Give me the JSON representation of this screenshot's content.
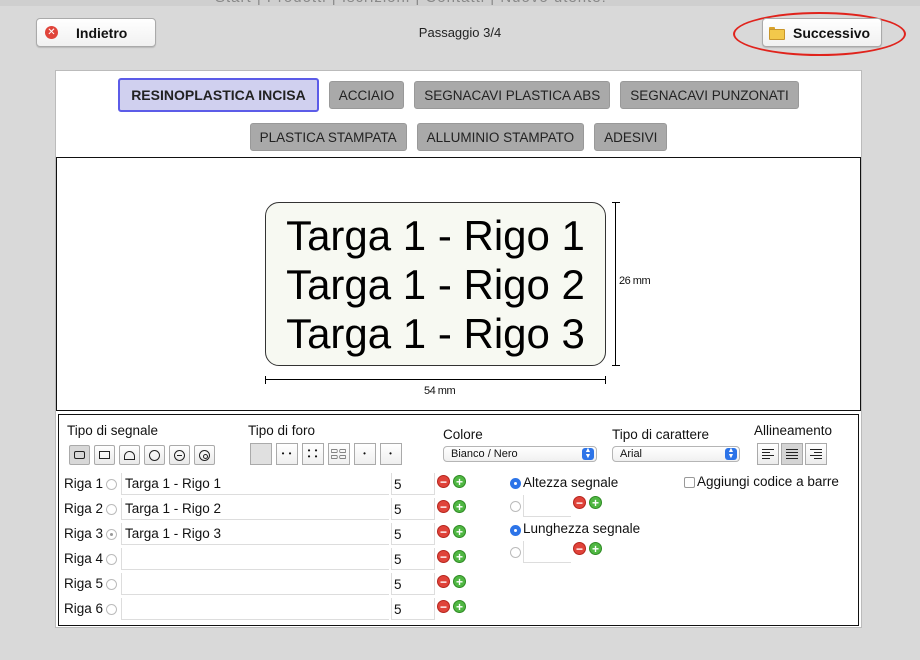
{
  "header": {
    "back_label": "Indietro",
    "next_label": "Successivo",
    "step_label": "Passaggio 3/4"
  },
  "materials_row1": [
    "RESINOPLASTICA INCISA",
    "ACCIAIO",
    "SEGNACAVI PLASTICA ABS",
    "SEGNACAVI PUNZONATI"
  ],
  "materials_row2": [
    "PLASTICA STAMPATA",
    "ALLUMINIO STAMPATO",
    "ADESIVI"
  ],
  "active_material": "RESINOPLASTICA INCISA",
  "preview": {
    "lines": [
      "Targa 1 - Rigo 1",
      "Targa 1 - Rigo 2",
      "Targa 1 - Rigo 3"
    ],
    "height_label": "26 mm",
    "width_label": "54 mm"
  },
  "controls": {
    "signal_type_title": "Tipo di segnale",
    "hole_type_title": "Tipo di foro",
    "color_title": "Colore",
    "color_value": "Bianco / Nero",
    "font_title": "Tipo di carattere",
    "font_value": "Arial",
    "align_title": "Allineamento",
    "height_option": "Altezza segnale",
    "length_option": "Lunghezza segnale",
    "barcode_label": "Aggiungi codice a barre"
  },
  "rows": [
    {
      "label": "Riga 1",
      "text": "Targa 1 - Rigo 1",
      "size": "5"
    },
    {
      "label": "Riga 2",
      "text": "Targa 1 - Rigo 2",
      "size": "5"
    },
    {
      "label": "Riga 3",
      "text": "Targa 1 - Rigo 3",
      "size": "5"
    },
    {
      "label": "Riga 4",
      "text": "",
      "size": "5"
    },
    {
      "label": "Riga 5",
      "text": "",
      "size": "5"
    },
    {
      "label": "Riga 6",
      "text": "",
      "size": "5"
    }
  ],
  "icons": {
    "back": "close-circle-icon",
    "next": "folder-icon",
    "minus": "minus-circle-icon",
    "plus": "plus-circle-icon"
  },
  "colors": {
    "accent_ring": "#e0231c",
    "active_material_border": "#5c5ce8",
    "select_arrow": "#2d74e8"
  }
}
